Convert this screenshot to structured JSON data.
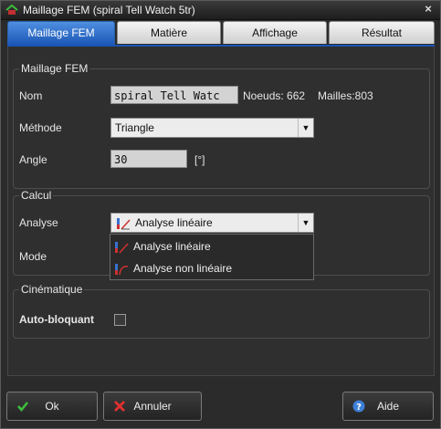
{
  "window": {
    "title": "Maillage FEM (spiral Tell Watch 5tr)",
    "close_symbol": "×"
  },
  "tabs": [
    {
      "label": "Maillage FEM",
      "active": true
    },
    {
      "label": "Matière",
      "active": false
    },
    {
      "label": "Affichage",
      "active": false
    },
    {
      "label": "Résultat",
      "active": false
    }
  ],
  "maillage": {
    "group_title": "Maillage FEM",
    "nom_label": "Nom",
    "nom_value": "spiral Tell Watc",
    "noeuds_info": "Noeuds: 662",
    "mailles_info": "Mailles:803",
    "methode_label": "Méthode",
    "methode_value": "Triangle",
    "angle_label": "Angle",
    "angle_value": "30",
    "angle_unit": "[°]"
  },
  "calcul": {
    "group_title": "Calcul",
    "analyse_label": "Analyse",
    "analyse_value": "Analyse linéaire",
    "mode_label": "Mode",
    "options": [
      "Analyse linéaire",
      "Analyse non linéaire"
    ]
  },
  "cinematique": {
    "group_title": "Cinématique",
    "auto_label": "Auto-bloquant",
    "auto_checked": false
  },
  "buttons": {
    "ok": "Ok",
    "cancel": "Annuler",
    "help": "Aide"
  },
  "colors": {
    "accent": "#1a55b5",
    "ok_icon": "#3fbf3f",
    "cancel_icon": "#e03030",
    "help_icon": "#3d7fd6"
  }
}
